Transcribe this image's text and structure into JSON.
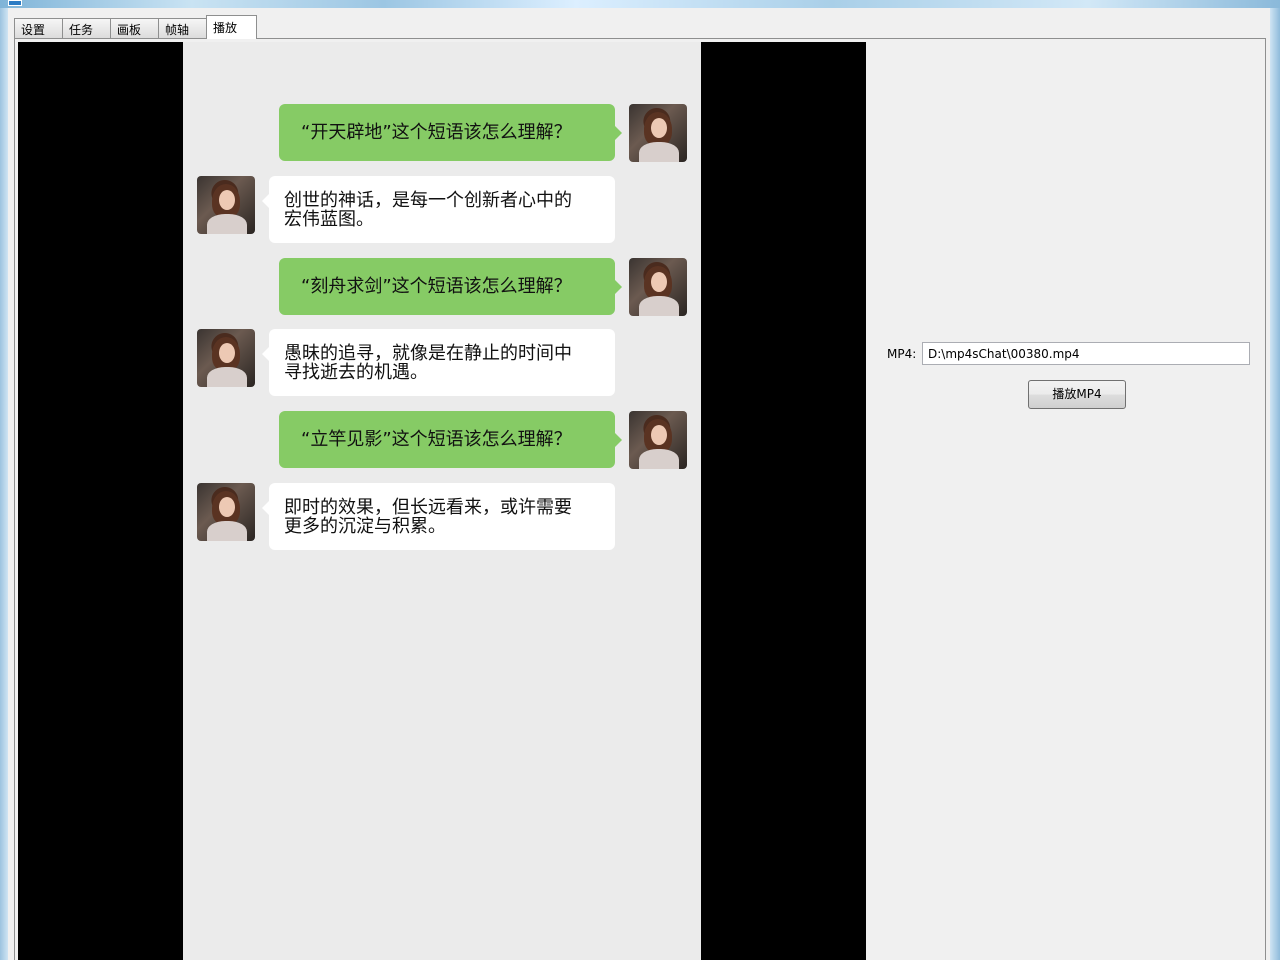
{
  "tabs": [
    {
      "label": "设置"
    },
    {
      "label": "任务"
    },
    {
      "label": "画板"
    },
    {
      "label": "帧轴"
    },
    {
      "label": "播放",
      "active": true
    }
  ],
  "chat": {
    "messages": [
      {
        "side": "right",
        "lines": [
          "“开天辟地”这个短语该怎么理解？"
        ]
      },
      {
        "side": "left",
        "lines": [
          "创世的神话，是每一个创新者心中的",
          "宏伟蓝图。"
        ]
      },
      {
        "side": "right",
        "lines": [
          "“刻舟求剑”这个短语该怎么理解？"
        ]
      },
      {
        "side": "left",
        "lines": [
          "愚昧的追寻，就像是在静止的时间中",
          "寻找逝去的机遇。"
        ]
      },
      {
        "side": "right",
        "lines": [
          "“立竿见影”这个短语该怎么理解？"
        ]
      },
      {
        "side": "left",
        "lines": [
          "即时的效果，但长远看来，或许需要",
          "更多的沉淀与积累。"
        ]
      }
    ]
  },
  "player": {
    "mp4_label": "MP4:",
    "mp4_path": "D:\\mp4sChat\\00380.mp4",
    "play_button": "播放MP4"
  },
  "colors": {
    "right_bubble": "#86cb65",
    "left_bubble": "#ffffff",
    "chat_background": "#ebebeb",
    "video_background": "#000000"
  }
}
